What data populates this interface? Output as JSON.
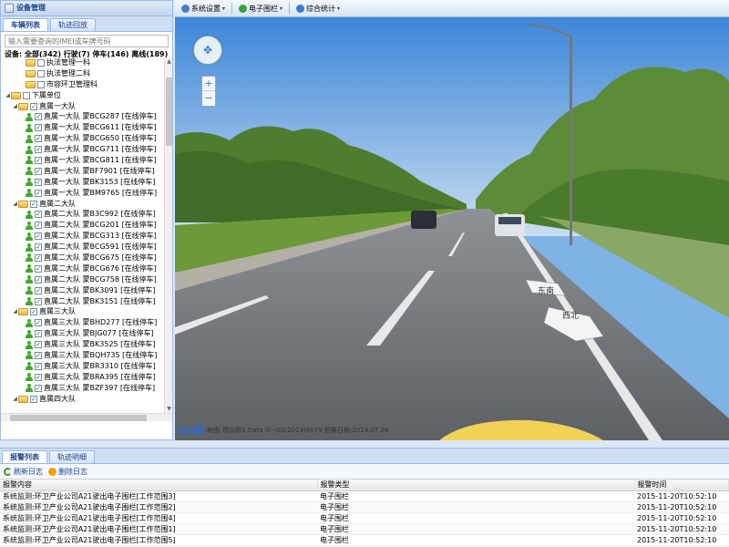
{
  "left_panel": {
    "title": "设备管理",
    "tabs": [
      "车辆列表",
      "轨迹回放"
    ],
    "search_placeholder": "输入需要查询的IMEI或车牌号码",
    "summary": "设备: 全部(342) 行驶(7) 停车(146) 离线(189)",
    "tree": [
      {
        "level": 2,
        "type": "group",
        "label": "执法管理一科"
      },
      {
        "level": 2,
        "type": "group",
        "label": "执法管理二科"
      },
      {
        "level": 2,
        "type": "group",
        "label": "市容环卫管理科"
      },
      {
        "level": 0,
        "type": "group",
        "label": "下属单位",
        "expanded": true
      },
      {
        "level": 1,
        "type": "group",
        "label": "直属一大队",
        "expanded": true,
        "checked": true
      },
      {
        "level": 2,
        "type": "vehicle",
        "label": "直属一大队 蒙BCG287 [在线停车]",
        "checked": true
      },
      {
        "level": 2,
        "type": "vehicle",
        "label": "直属一大队 蒙BCG611 [在线停车]",
        "checked": true
      },
      {
        "level": 2,
        "type": "vehicle",
        "label": "直属一大队 蒙BCG650 [在线停车]",
        "checked": true
      },
      {
        "level": 2,
        "type": "vehicle",
        "label": "直属一大队 蒙BCG711 [在线停车]",
        "checked": true
      },
      {
        "level": 2,
        "type": "vehicle",
        "label": "直属一大队 蒙BCG811 [在线停车]",
        "checked": true
      },
      {
        "level": 2,
        "type": "vehicle",
        "label": "直属一大队 蒙BF7901 [在线停车]",
        "checked": true
      },
      {
        "level": 2,
        "type": "vehicle",
        "label": "直属一大队 蒙BK3153 [在线停车]",
        "checked": true
      },
      {
        "level": 2,
        "type": "vehicle",
        "label": "直属一大队 蒙BM9765 [在线停车]",
        "checked": true
      },
      {
        "level": 1,
        "type": "group",
        "label": "直属二大队",
        "expanded": true,
        "checked": true
      },
      {
        "level": 2,
        "type": "vehicle",
        "label": "直属二大队 蒙B3C992 [在线停车]",
        "checked": true
      },
      {
        "level": 2,
        "type": "vehicle",
        "label": "直属二大队 蒙BCG201 [在线停车]",
        "checked": true
      },
      {
        "level": 2,
        "type": "vehicle",
        "label": "直属二大队 蒙BCG313 [在线停车]",
        "checked": true
      },
      {
        "level": 2,
        "type": "vehicle",
        "label": "直属二大队 蒙BCG591 [在线停车]",
        "checked": true
      },
      {
        "level": 2,
        "type": "vehicle",
        "label": "直属二大队 蒙BCG675 [在线停车]",
        "checked": true
      },
      {
        "level": 2,
        "type": "vehicle",
        "label": "直属二大队 蒙BCG676 [在线停车]",
        "checked": true
      },
      {
        "level": 2,
        "type": "vehicle",
        "label": "直属二大队 蒙BCG758 [在线停车]",
        "checked": true
      },
      {
        "level": 2,
        "type": "vehicle",
        "label": "直属二大队 蒙BK3091 [在线停车]",
        "checked": true
      },
      {
        "level": 2,
        "type": "vehicle",
        "label": "直属二大队 蒙BK3151 [在线停车]",
        "checked": true
      },
      {
        "level": 1,
        "type": "group",
        "label": "直属三大队",
        "expanded": true,
        "checked": true
      },
      {
        "level": 2,
        "type": "vehicle",
        "label": "直属三大队 蒙BHD277 [在线停车]",
        "checked": true
      },
      {
        "level": 2,
        "type": "vehicle",
        "label": "直属三大队 蒙BJG077 [在线停车]",
        "checked": true
      },
      {
        "level": 2,
        "type": "vehicle",
        "label": "直属三大队 蒙BK3525 [在线停车]",
        "checked": true
      },
      {
        "level": 2,
        "type": "vehicle",
        "label": "直属三大队 蒙BQH735 [在线停车]",
        "checked": true
      },
      {
        "level": 2,
        "type": "vehicle",
        "label": "直属三大队 蒙BR3310 [在线停车]",
        "checked": true
      },
      {
        "level": 2,
        "type": "vehicle",
        "label": "直属三大队 蒙BRA395 [在线停车]",
        "checked": true
      },
      {
        "level": 2,
        "type": "vehicle",
        "label": "直属三大队 蒙BZF397 [在线停车]",
        "checked": true
      },
      {
        "level": 1,
        "type": "group",
        "label": "直属四大队",
        "expanded": true,
        "checked": true
      }
    ]
  },
  "toolbar": {
    "items": [
      {
        "label": "系统设置",
        "icon": "settings-icon",
        "color": "#4a7bc8"
      },
      {
        "label": "电子围栏",
        "icon": "fence-icon",
        "color": "#3aa33a"
      },
      {
        "label": "综合统计",
        "icon": "stats-icon",
        "color": "#3a7ad8"
      }
    ]
  },
  "map": {
    "direction_labels": [
      "东南",
      "西北"
    ],
    "logo_text": "Bai",
    "logo_text2": "度",
    "logo_caption": "地图",
    "footer_text": "建设踢1  Data © -GS(2014)6079   拍摄日期:2014.07.26"
  },
  "bottom_panel": {
    "tabs": [
      "报警列表",
      "轨迹明细"
    ],
    "refresh_label": "刷新日志",
    "delete_label": "删除日志",
    "columns": [
      "报警内容",
      "报警类型",
      "报警时间"
    ],
    "rows": [
      [
        "系统监测:环卫产业公司A21驶出电子围栏[工作范围3]",
        "电子围栏",
        "2015-11-20T10:52:10"
      ],
      [
        "系统监测:环卫产业公司A21驶出电子围栏[工作范围2]",
        "电子围栏",
        "2015-11-20T10:52:10"
      ],
      [
        "系统监测:环卫产业公司A21驶出电子围栏[工作范围4]",
        "电子围栏",
        "2015-11-20T10:52:10"
      ],
      [
        "系统监测:环卫产业公司A21驶出电子围栏[工作范围1]",
        "电子围栏",
        "2015-11-20T10:52:10"
      ],
      [
        "系统监测:环卫产业公司A21驶出电子围栏[工作范围5]",
        "电子围栏",
        "2015-11-20T10:52:10"
      ]
    ]
  }
}
